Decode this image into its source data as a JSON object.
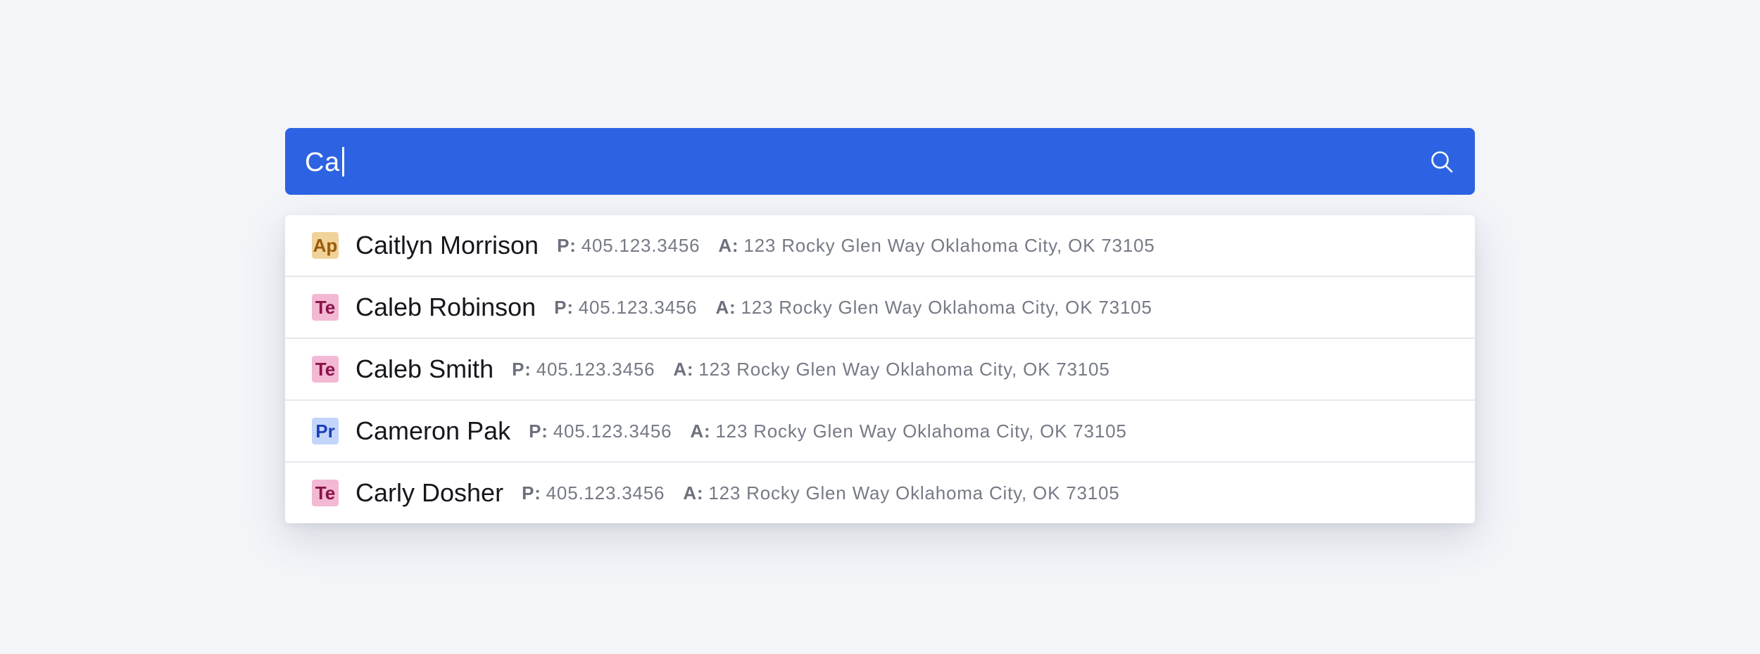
{
  "search": {
    "value": "Ca",
    "icon": "search-icon",
    "background": "#2d63e3"
  },
  "results": [
    {
      "badge": "Ap",
      "badge_bg": "#f0d39a",
      "badge_fg": "#9a5a08",
      "name": "Caitlyn Morrison",
      "phone_label": "P:",
      "phone": "405.123.3456",
      "address_label": "A:",
      "address": "123 Rocky Glen Way Oklahoma City, OK 73105"
    },
    {
      "badge": "Te",
      "badge_bg": "#f3b8d4",
      "badge_fg": "#8a1447",
      "name": "Caleb Robinson",
      "phone_label": "P:",
      "phone": "405.123.3456",
      "address_label": "A:",
      "address": "123 Rocky Glen Way Oklahoma City, OK 73105"
    },
    {
      "badge": "Te",
      "badge_bg": "#f3b8d4",
      "badge_fg": "#8a1447",
      "name": "Caleb Smith",
      "phone_label": "P:",
      "phone": "405.123.3456",
      "address_label": "A:",
      "address": "123 Rocky Glen Way Oklahoma City, OK 73105"
    },
    {
      "badge": "Pr",
      "badge_bg": "#c3d5fb",
      "badge_fg": "#1d3fb5",
      "name": "Cameron Pak",
      "phone_label": "P:",
      "phone": "405.123.3456",
      "address_label": "A:",
      "address": "123 Rocky Glen Way Oklahoma City, OK 73105"
    },
    {
      "badge": "Te",
      "badge_bg": "#f3b8d4",
      "badge_fg": "#8a1447",
      "name": "Carly Dosher",
      "phone_label": "P:",
      "phone": "405.123.3456",
      "address_label": "A:",
      "address": "123 Rocky Glen Way Oklahoma City, OK 73105"
    }
  ]
}
